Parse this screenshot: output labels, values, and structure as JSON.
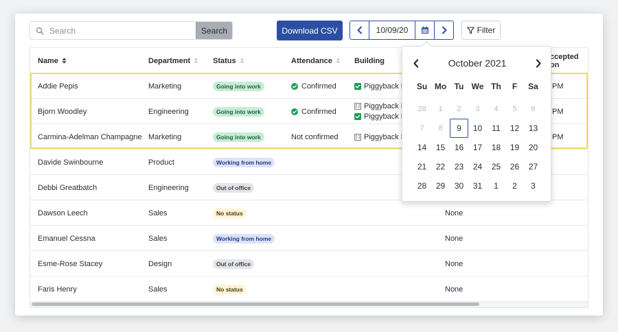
{
  "toolbar": {
    "search_placeholder": "Search",
    "search_button": "Search",
    "download_csv": "Download CSV",
    "date_value": "10/09/20",
    "filter_label": "Filter"
  },
  "columns": [
    "Name",
    "Department",
    "Status",
    "Attendance",
    "Building",
    "ccepted on"
  ],
  "rows": [
    {
      "name": "Addie Pepis",
      "department": "Marketing",
      "status": "Going into work",
      "attendance": "Confirmed",
      "building": [
        "Piggyback H"
      ],
      "accepted": "PM"
    },
    {
      "name": "Bjorn Woodley",
      "department": "Engineering",
      "status": "Going into work",
      "attendance": "Confirmed",
      "building": [
        "Piggyback H",
        "Piggyback B"
      ],
      "accepted": "PM"
    },
    {
      "name": "Carmina-Adelman Champagne",
      "department": "Marketing",
      "status": "Going into work",
      "attendance": "Not confirmed",
      "building": [
        "Piggyback H"
      ],
      "accepted": "PM"
    },
    {
      "name": "Davide Swinbourne",
      "department": "Product",
      "status": "Working from home"
    },
    {
      "name": "Debbi Greatbatch",
      "department": "Engineering",
      "status": "Out of office"
    },
    {
      "name": "Dawson Leech",
      "department": "Sales",
      "status": "No status",
      "building_none": "None"
    },
    {
      "name": "Emanuel Cessna",
      "department": "Sales",
      "status": "Working from home",
      "building_none": "None"
    },
    {
      "name": "Esme-Rose Stacey",
      "department": "Design",
      "status": "Out of office",
      "building_none": "None"
    },
    {
      "name": "Faris Henry",
      "department": "Sales",
      "status": "No status",
      "building_none": "None"
    }
  ],
  "calendar": {
    "title": "October 2021",
    "weekdays": [
      "Su",
      "Mo",
      "Tu",
      "We",
      "Th",
      "F",
      "Sa"
    ],
    "weeks": [
      [
        {
          "d": "28",
          "m": true
        },
        {
          "d": "1",
          "m": true
        },
        {
          "d": "2",
          "m": true
        },
        {
          "d": "3",
          "m": true
        },
        {
          "d": "4",
          "m": true
        },
        {
          "d": "5",
          "m": true
        },
        {
          "d": "6",
          "m": true
        }
      ],
      [
        {
          "d": "7",
          "m": true
        },
        {
          "d": "8",
          "m": true
        },
        {
          "d": "9",
          "sel": true
        },
        {
          "d": "10"
        },
        {
          "d": "11"
        },
        {
          "d": "12"
        },
        {
          "d": "13"
        }
      ],
      [
        {
          "d": "14"
        },
        {
          "d": "15"
        },
        {
          "d": "16"
        },
        {
          "d": "17"
        },
        {
          "d": "18"
        },
        {
          "d": "19"
        },
        {
          "d": "20"
        }
      ],
      [
        {
          "d": "21"
        },
        {
          "d": "22"
        },
        {
          "d": "23"
        },
        {
          "d": "24"
        },
        {
          "d": "25"
        },
        {
          "d": "26"
        },
        {
          "d": "27"
        }
      ],
      [
        {
          "d": "28"
        },
        {
          "d": "29"
        },
        {
          "d": "30"
        },
        {
          "d": "31"
        },
        {
          "d": "1"
        },
        {
          "d": "2"
        },
        {
          "d": "3"
        }
      ]
    ]
  },
  "colors": {
    "primary": "#2c4fa3",
    "selected_row_outline": "#f7d56b",
    "status_going": "#c7ecd6",
    "status_home": "#dbe2fb",
    "status_out": "#e2e4e7",
    "status_none": "#fdf3d6",
    "confirmed_green": "#1f9d55"
  },
  "icons": {
    "search": "search-icon",
    "prev": "chevron-left-icon",
    "next": "chevron-right-icon",
    "calendar": "calendar-icon",
    "filter": "filter-icon",
    "confirmed": "check-circle-icon",
    "building": "building-icon",
    "building_checked": "checkbox-checked-icon"
  }
}
